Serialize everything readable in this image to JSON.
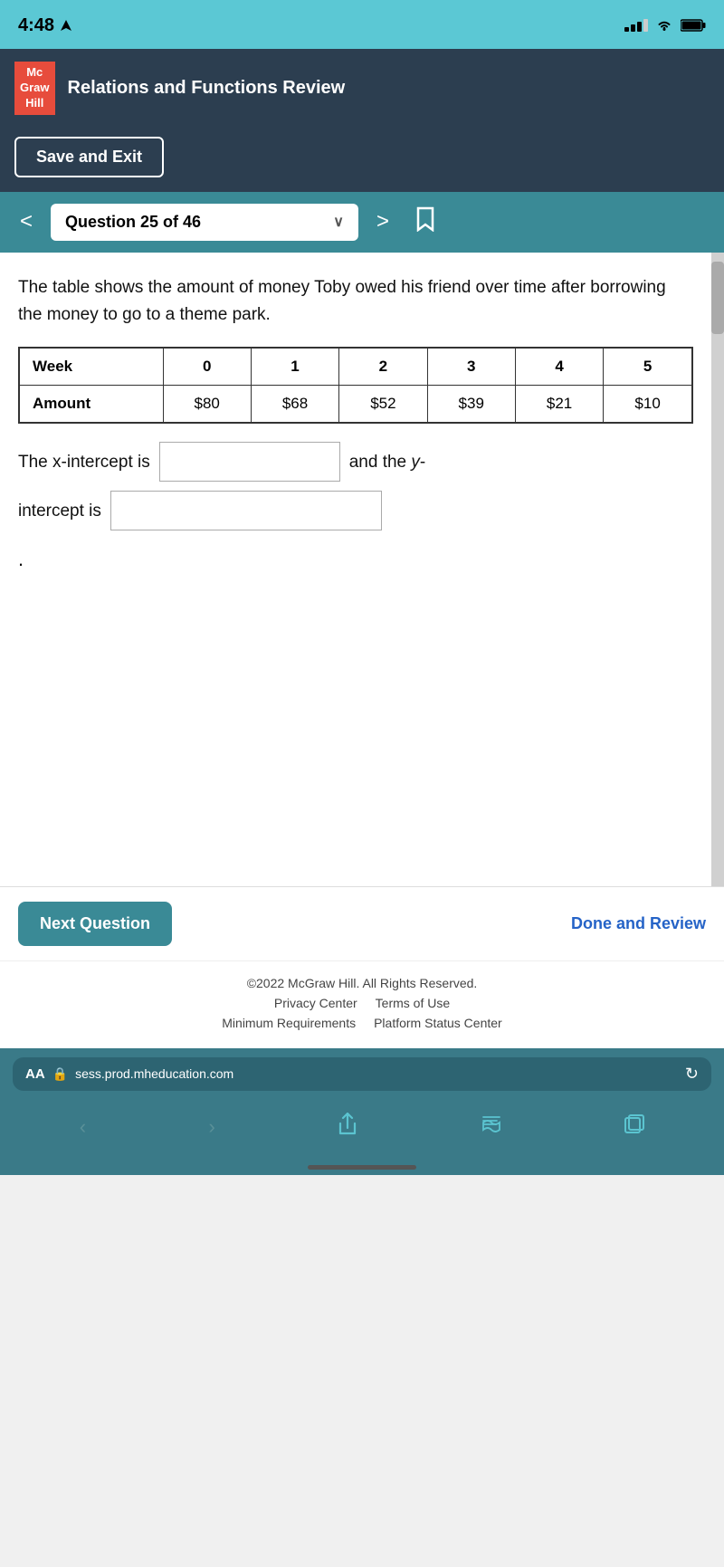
{
  "statusBar": {
    "time": "4:48",
    "locationArrow": "◀",
    "signal": "signal",
    "wifi": "wifi",
    "battery": "battery"
  },
  "header": {
    "logo": {
      "line1": "Mc",
      "line2": "Graw",
      "line3": "Hill"
    },
    "title": "Relations and Functions Review"
  },
  "saveExit": {
    "label": "Save and Exit"
  },
  "questionNav": {
    "prevArrow": "<",
    "nextArrow": ">",
    "questionLabel": "Question 25 of 46",
    "chevron": "∨",
    "bookmark": "🔖"
  },
  "question": {
    "text": "The table shows the amount of money Toby owed his friend over time after borrowing the money to go to a theme park.",
    "table": {
      "headers": [
        "Week",
        "0",
        "1",
        "2",
        "3",
        "4",
        "5"
      ],
      "row": {
        "label": "Amount",
        "values": [
          "$80",
          "$68",
          "$52",
          "$39",
          "$21",
          "$10"
        ]
      }
    },
    "xInterceptLabel": "The x-intercept is",
    "andTheY": "and the y-",
    "interceptIs": "intercept is",
    "period": ".",
    "xInterceptValue": "",
    "yInterceptValue": ""
  },
  "bottomBar": {
    "nextQuestion": "Next Question",
    "doneReview": "Done and Review"
  },
  "footer": {
    "copyright": "©2022 McGraw Hill. All Rights Reserved.",
    "links1": [
      "Privacy Center",
      "Terms of Use"
    ],
    "links2": [
      "Minimum Requirements",
      "Platform Status Center"
    ]
  },
  "browserBar": {
    "aa": "AA",
    "lock": "🔒",
    "url": "sess.prod.mheducation.com",
    "reload": "↻"
  },
  "iosNav": {
    "back": "‹",
    "forward": "›",
    "share": "↑",
    "bookmarks": "📖",
    "tabs": "⧉"
  }
}
